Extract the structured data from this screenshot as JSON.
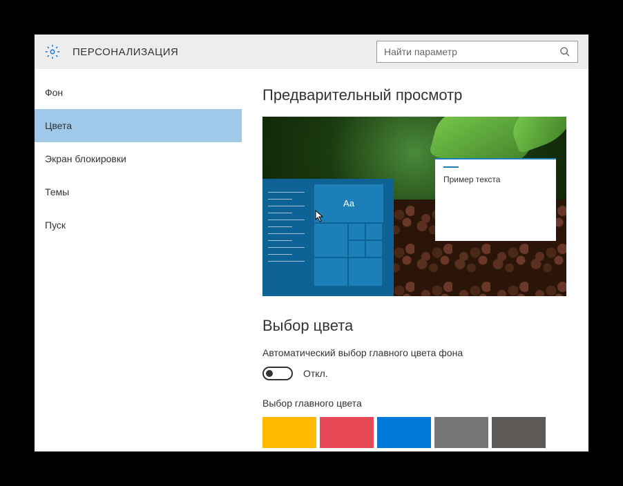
{
  "header": {
    "title": "ПЕРСОНАЛИЗАЦИЯ",
    "search_placeholder": "Найти параметр"
  },
  "sidebar": {
    "items": [
      {
        "label": "Фон",
        "active": false
      },
      {
        "label": "Цвета",
        "active": true
      },
      {
        "label": "Экран блокировки",
        "active": false
      },
      {
        "label": "Темы",
        "active": false
      },
      {
        "label": "Пуск",
        "active": false
      }
    ]
  },
  "content": {
    "preview_title": "Предварительный просмотр",
    "preview_tile_text": "Aa",
    "sample_window_text": "Пример текста",
    "color_section_title": "Выбор цвета",
    "auto_color_label": "Автоматический выбор главного цвета фона",
    "toggle_state_label": "Откл.",
    "toggle_state": false,
    "accent_color_label": "Выбор главного цвета",
    "colors": [
      "#ffb900",
      "#e74856",
      "#0078d7",
      "#767676",
      "#5d5a58"
    ]
  }
}
